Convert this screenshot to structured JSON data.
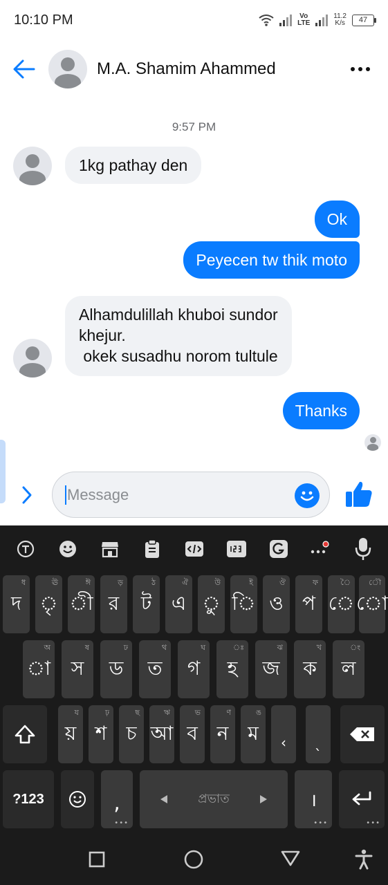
{
  "status": {
    "time": "10:10 PM",
    "network_type": "Vo\nLTE",
    "speed_value": "11.2",
    "speed_unit": "K/s",
    "battery": "47"
  },
  "header": {
    "contact_name": "M.A. Shamim Ahammed"
  },
  "conversation": {
    "timestamp": "9:57 PM",
    "messages": [
      {
        "direction": "incoming",
        "text": "1kg pathay den"
      },
      {
        "direction": "outgoing",
        "text": "Ok"
      },
      {
        "direction": "outgoing",
        "text": "Peyecen tw thik moto"
      },
      {
        "direction": "incoming",
        "text": "Alhamdulillah khuboi sundor\nkhejur.\n okek susadhu norom tultule"
      },
      {
        "direction": "outgoing",
        "text": "Thanks"
      }
    ]
  },
  "composer": {
    "placeholder": "Message",
    "value": ""
  },
  "keyboard": {
    "row1": [
      {
        "main": "দ",
        "hint": "ধ"
      },
      {
        "main": "ৃ",
        "hint": "ঊ"
      },
      {
        "main": "ী",
        "hint": "ঈ"
      },
      {
        "main": "র",
        "hint": "ড়"
      },
      {
        "main": "ট",
        "hint": "ঠ"
      },
      {
        "main": "এ",
        "hint": "ঐ"
      },
      {
        "main": "ু",
        "hint": "উ"
      },
      {
        "main": "ি",
        "hint": "ই"
      },
      {
        "main": "ও",
        "hint": "ঔ"
      },
      {
        "main": "প",
        "hint": "ফ"
      },
      {
        "main": "ে",
        "hint": "ৈ"
      },
      {
        "main": "ো",
        "hint": "ৌ"
      }
    ],
    "row2": [
      {
        "main": "া",
        "hint": "অ"
      },
      {
        "main": "স",
        "hint": "ষ"
      },
      {
        "main": "ড",
        "hint": "ঢ"
      },
      {
        "main": "ত",
        "hint": "থ"
      },
      {
        "main": "গ",
        "hint": "ঘ"
      },
      {
        "main": "হ",
        "hint": "ঃ"
      },
      {
        "main": "জ",
        "hint": "ঝ"
      },
      {
        "main": "ক",
        "hint": "খ"
      },
      {
        "main": "ল",
        "hint": "ং"
      }
    ],
    "row3": [
      {
        "main": "য়",
        "hint": "য"
      },
      {
        "main": "শ",
        "hint": "ঢ়"
      },
      {
        "main": "চ",
        "hint": "ছ"
      },
      {
        "main": "আ",
        "hint": "ঋ"
      },
      {
        "main": "ব",
        "hint": "ভ"
      },
      {
        "main": "ন",
        "hint": "ণ"
      },
      {
        "main": "ম",
        "hint": "ঙ"
      },
      {
        "main": "‹",
        "hint": ""
      },
      {
        "main": "ˎ",
        "hint": ""
      }
    ],
    "symbols_label": "?123",
    "comma_label": ",",
    "space_label": "প্রভাত",
    "danda_label": "।"
  },
  "colors": {
    "accent": "#0a7cff",
    "bubble_in": "#f0f2f5",
    "keyboard_bg": "#1b1b1b",
    "key_bg": "#3a3a3a"
  }
}
